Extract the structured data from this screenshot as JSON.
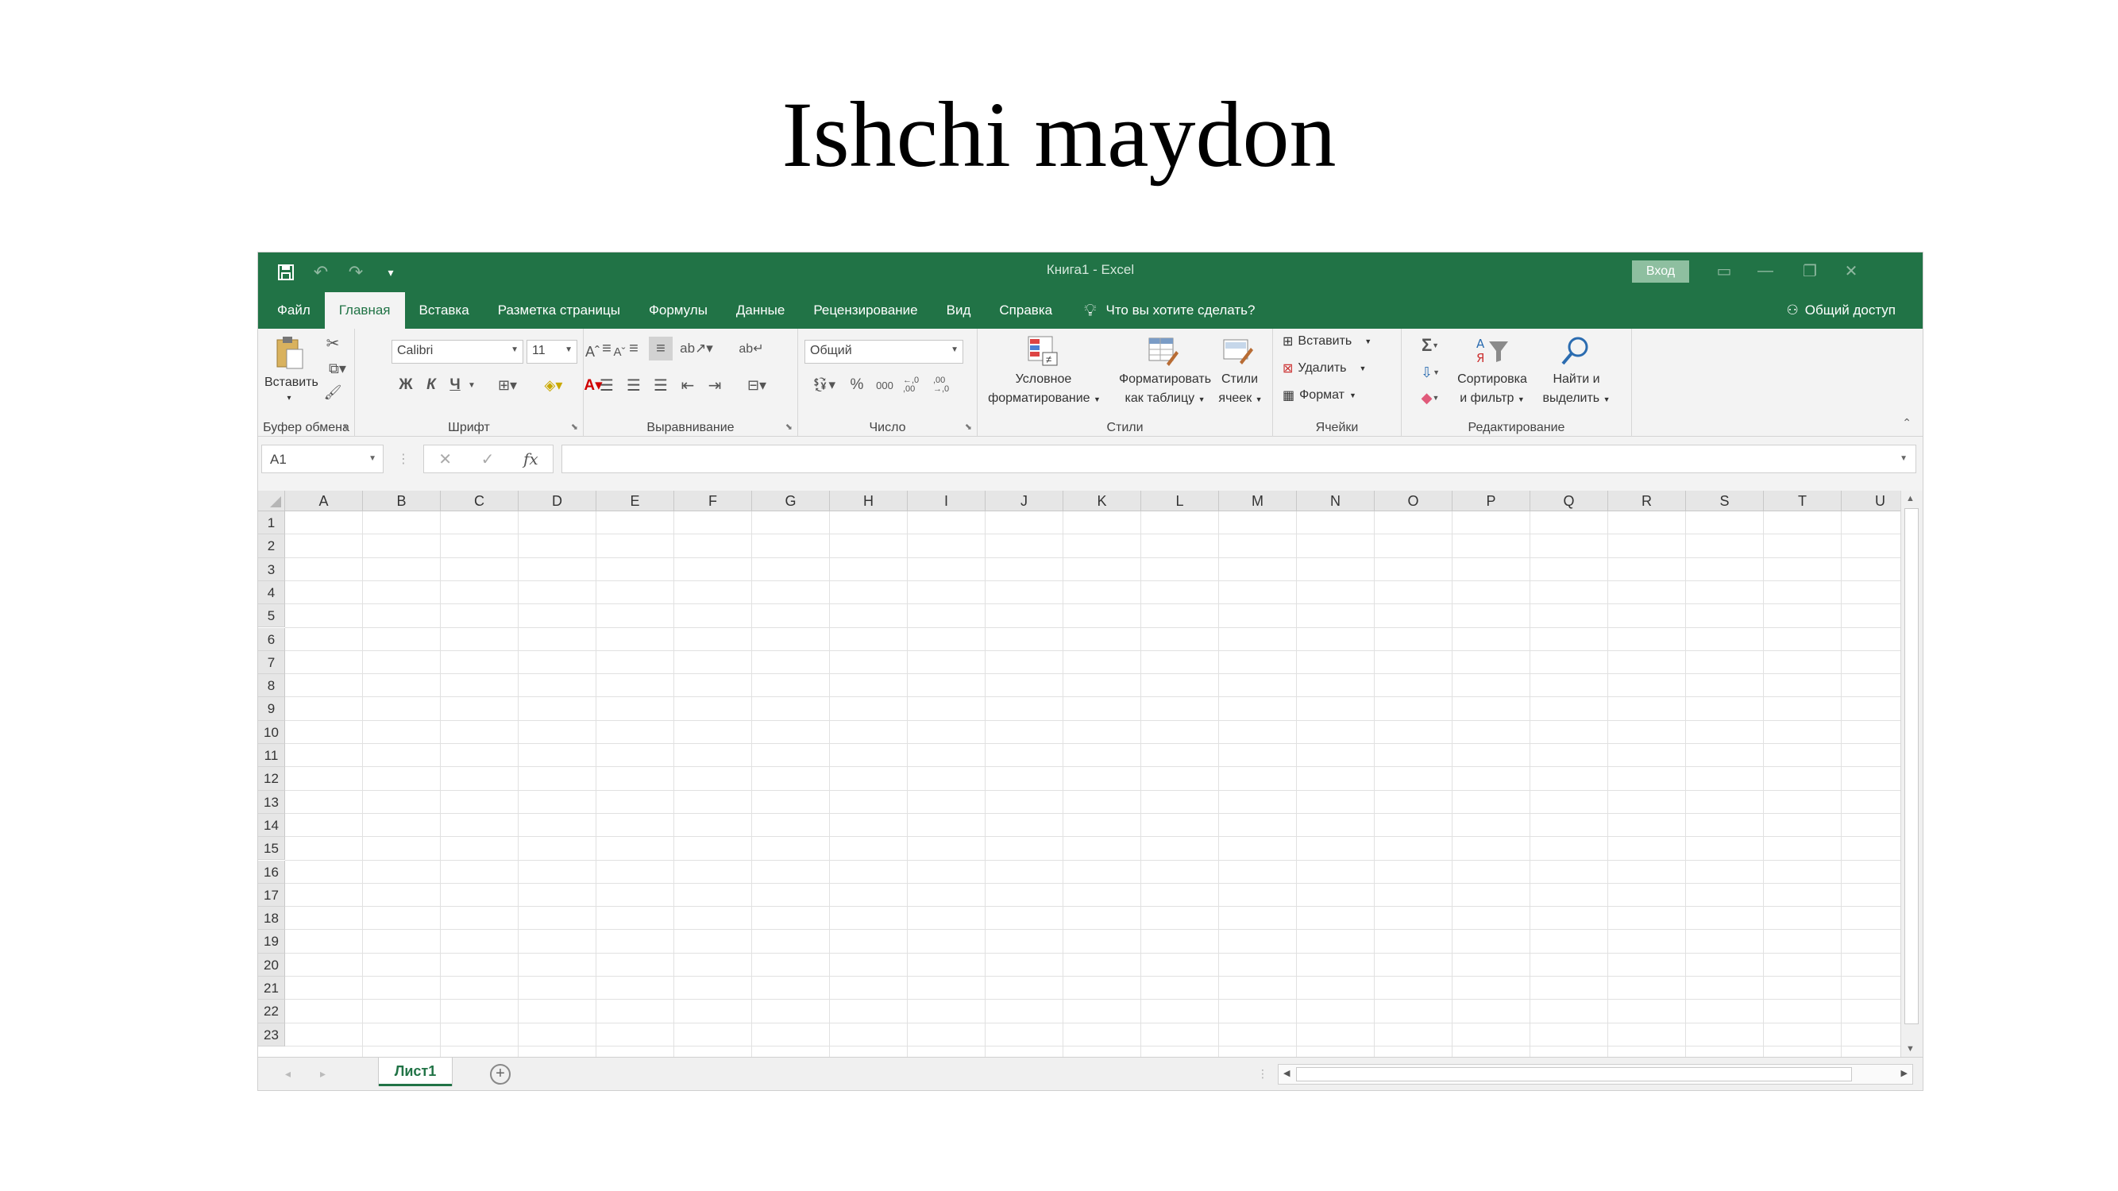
{
  "slide": {
    "title": "Ishchi maydon"
  },
  "window": {
    "title": "Книга1  -  Excel",
    "signin": "Вход"
  },
  "tabs": [
    "Файл",
    "Главная",
    "Вставка",
    "Разметка страницы",
    "Формулы",
    "Данные",
    "Рецензирование",
    "Вид",
    "Справка"
  ],
  "active_tab": "Главная",
  "tellme": "Что вы хотите сделать?",
  "share": "Общий доступ",
  "ribbon": {
    "clipboard": {
      "label": "Буфер обмена",
      "paste": "Вставить"
    },
    "font": {
      "label": "Шрифт",
      "name": "Calibri",
      "size": "11",
      "bold": "Ж",
      "italic": "К",
      "underline": "Ч"
    },
    "alignment": {
      "label": "Выравнивание"
    },
    "number": {
      "label": "Число",
      "format": "Общий",
      "percent": "%",
      "thousands": "000",
      "inc_decimal": "←,0 ,00",
      "dec_decimal": ",00 →,0"
    },
    "styles": {
      "label": "Стили",
      "conditional_1": "Условное",
      "conditional_2": "форматирование",
      "as_table_1": "Форматировать",
      "as_table_2": "как таблицу",
      "cell_styles_1": "Стили",
      "cell_styles_2": "ячеек"
    },
    "cells": {
      "label": "Ячейки",
      "insert": "Вставить",
      "delete": "Удалить",
      "format": "Формат"
    },
    "editing": {
      "label": "Редактирование",
      "sort_1": "Сортировка",
      "sort_2": "и фильтр",
      "find_1": "Найти и",
      "find_2": "выделить"
    }
  },
  "formula_bar": {
    "name_box": "A1",
    "fx": "fx",
    "value": ""
  },
  "grid": {
    "columns": [
      "A",
      "B",
      "C",
      "D",
      "E",
      "F",
      "G",
      "H",
      "I",
      "J",
      "K",
      "L",
      "M",
      "N",
      "O",
      "P",
      "Q",
      "R",
      "S",
      "T",
      "U"
    ],
    "rows": [
      "1",
      "2",
      "3",
      "4",
      "5",
      "6",
      "7",
      "8",
      "9",
      "10",
      "11",
      "12",
      "13",
      "14",
      "15",
      "16",
      "17",
      "18",
      "19",
      "20",
      "21",
      "22",
      "23"
    ]
  },
  "sheets": [
    "Лист1"
  ]
}
